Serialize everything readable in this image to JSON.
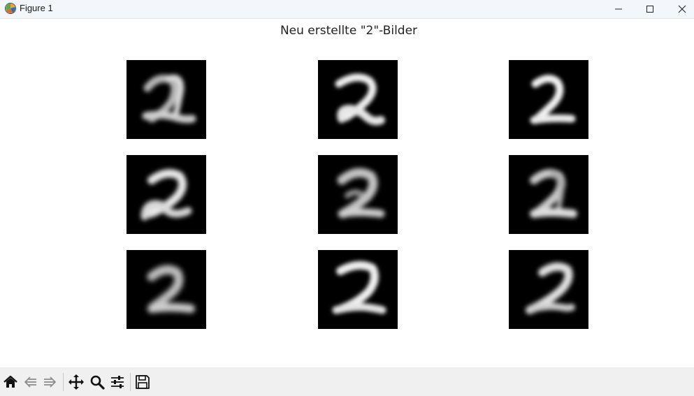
{
  "window": {
    "title": "Figure 1",
    "controls": [
      "minimize-icon",
      "maximize-icon",
      "close-icon"
    ]
  },
  "figure": {
    "title": "Neu erstellte \"2\"-Bilder",
    "grid": {
      "rows": 3,
      "cols": 3
    },
    "images": [
      {
        "content": "generated digit 2",
        "row": 1,
        "col": 1
      },
      {
        "content": "generated digit 2",
        "row": 1,
        "col": 2
      },
      {
        "content": "generated digit 2",
        "row": 1,
        "col": 3
      },
      {
        "content": "generated digit 2",
        "row": 2,
        "col": 1
      },
      {
        "content": "generated digit 2",
        "row": 2,
        "col": 2
      },
      {
        "content": "generated digit 2",
        "row": 2,
        "col": 3
      },
      {
        "content": "generated digit 2",
        "row": 3,
        "col": 1
      },
      {
        "content": "generated digit 2",
        "row": 3,
        "col": 2
      },
      {
        "content": "generated digit 2",
        "row": 3,
        "col": 3
      }
    ]
  },
  "toolbar": {
    "buttons": [
      "home-icon",
      "back-icon",
      "forward-icon",
      "pan-icon",
      "zoom-icon",
      "configure-subplots-icon",
      "save-icon"
    ]
  }
}
